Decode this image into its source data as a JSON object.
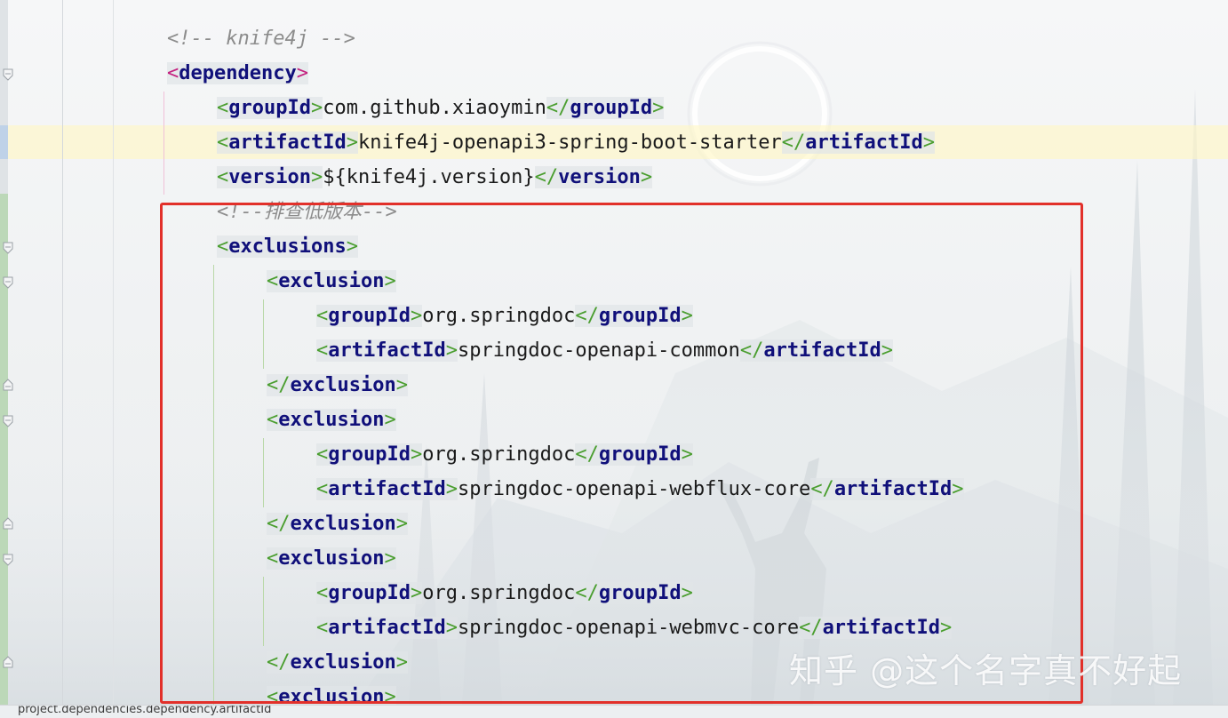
{
  "editor": {
    "comment_top": "<!-- knife4j -->",
    "comment_exclude": "<!--排查低版本-->",
    "lines": [
      {
        "open": "dependency"
      },
      {
        "open": "groupId",
        "text": "com.github.xiaoymin",
        "close": "groupId"
      },
      {
        "open": "artifactId",
        "text": "knife4j-openapi3-spring-boot-starter",
        "close": "artifactId"
      },
      {
        "open": "version",
        "text": "${knife4j.version}",
        "close": "version"
      },
      {
        "open": "exclusions"
      },
      {
        "open": "exclusion"
      },
      {
        "open": "groupId",
        "text": "org.springdoc",
        "close": "groupId"
      },
      {
        "open": "artifactId",
        "text": "springdoc-openapi-common",
        "close": "artifactId"
      },
      {
        "close": "exclusion"
      },
      {
        "open": "exclusion"
      },
      {
        "open": "groupId",
        "text": "org.springdoc",
        "close": "groupId"
      },
      {
        "open": "artifactId",
        "text": "springdoc-openapi-webflux-core",
        "close": "artifactId"
      },
      {
        "close": "exclusion"
      },
      {
        "open": "exclusion"
      },
      {
        "open": "groupId",
        "text": "org.springdoc",
        "close": "groupId"
      },
      {
        "open": "artifactId",
        "text": "springdoc-openapi-webmvc-core",
        "close": "artifactId"
      },
      {
        "close": "exclusion"
      },
      {
        "open": "exclusion"
      }
    ]
  },
  "watermark": "知乎 @这个名字真不好起",
  "statusbar": {
    "text": "project.dependencies.dependency.artifactId"
  },
  "colors": {
    "tag_name": "#10107a",
    "bracket": "#4a9e2f",
    "comment": "#8c8c8c",
    "highlight_box": "#e2302a"
  }
}
